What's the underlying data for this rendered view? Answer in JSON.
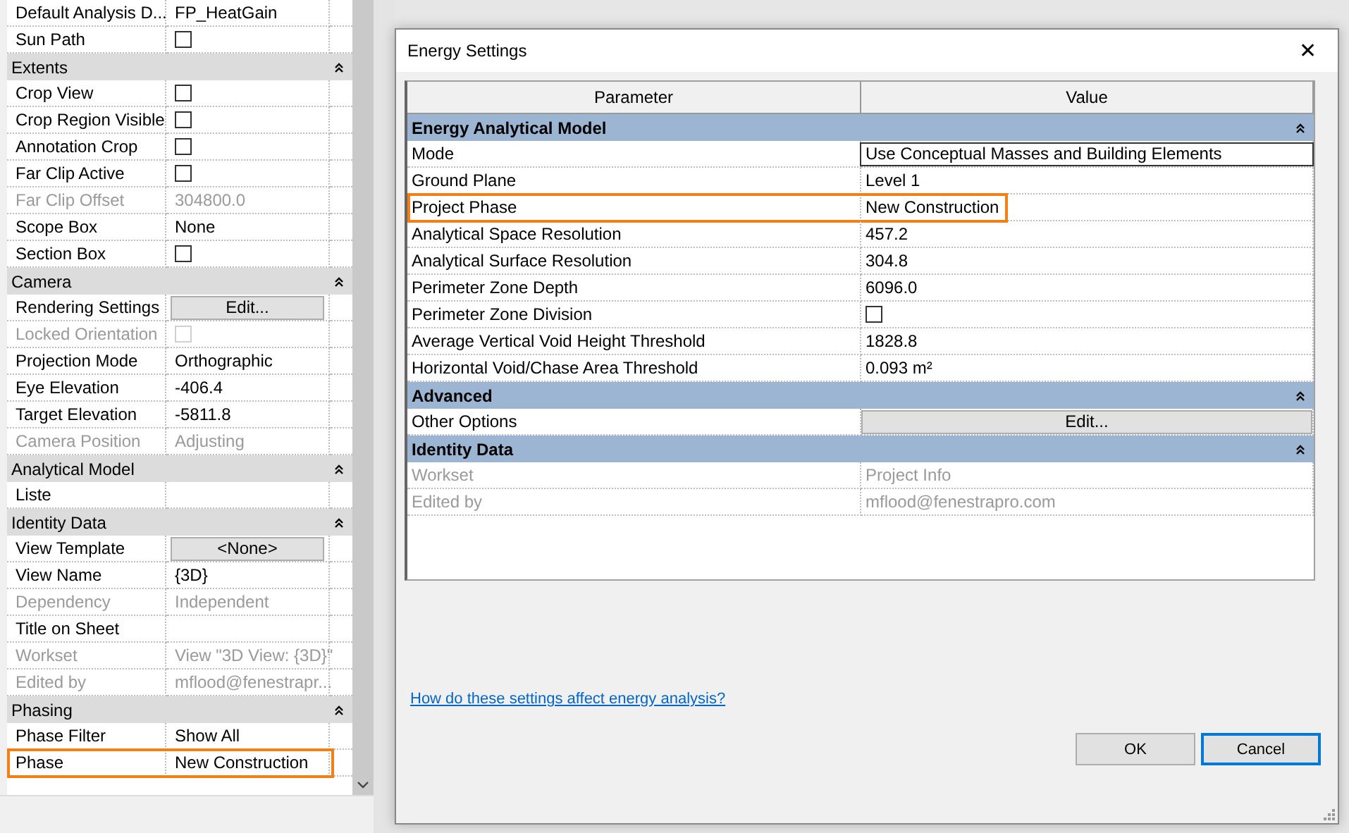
{
  "properties_panel": {
    "groups": [
      {
        "rows": [
          {
            "label": "Default Analysis D...",
            "kind": "text",
            "value": "FP_HeatGain",
            "disabled": false,
            "highlighted": false
          },
          {
            "label": "Sun Path",
            "kind": "checkbox",
            "checked": false,
            "disabled": false,
            "highlighted": false
          }
        ]
      },
      {
        "title": "Extents",
        "rows": [
          {
            "label": "Crop View",
            "kind": "checkbox",
            "checked": false,
            "disabled": false,
            "highlighted": false
          },
          {
            "label": "Crop Region Visible",
            "kind": "checkbox",
            "checked": false,
            "disabled": false,
            "highlighted": false
          },
          {
            "label": "Annotation Crop",
            "kind": "checkbox",
            "checked": false,
            "disabled": false,
            "highlighted": false
          },
          {
            "label": "Far Clip Active",
            "kind": "checkbox",
            "checked": false,
            "disabled": false,
            "highlighted": false
          },
          {
            "label": "Far Clip Offset",
            "kind": "text",
            "value": "304800.0",
            "disabled": true,
            "highlighted": false
          },
          {
            "label": "Scope Box",
            "kind": "text",
            "value": "None",
            "disabled": false,
            "highlighted": false
          },
          {
            "label": "Section Box",
            "kind": "checkbox",
            "checked": false,
            "disabled": false,
            "highlighted": false
          }
        ]
      },
      {
        "title": "Camera",
        "rows": [
          {
            "label": "Rendering Settings",
            "kind": "button",
            "value": "Edit...",
            "disabled": false,
            "highlighted": false
          },
          {
            "label": "Locked Orientation",
            "kind": "checkbox",
            "checked": false,
            "disabled": true,
            "highlighted": false
          },
          {
            "label": "Projection Mode",
            "kind": "text",
            "value": "Orthographic",
            "disabled": false,
            "highlighted": false
          },
          {
            "label": "Eye Elevation",
            "kind": "text",
            "value": "-406.4",
            "disabled": false,
            "highlighted": false
          },
          {
            "label": "Target Elevation",
            "kind": "text",
            "value": "-5811.8",
            "disabled": false,
            "highlighted": false
          },
          {
            "label": "Camera Position",
            "kind": "text",
            "value": "Adjusting",
            "disabled": true,
            "highlighted": false
          }
        ]
      },
      {
        "title": "Analytical Model",
        "rows": [
          {
            "label": "Liste",
            "kind": "text",
            "disabled": false,
            "highlighted": false
          }
        ]
      },
      {
        "title": "Identity Data",
        "rows": [
          {
            "label": "View Template",
            "kind": "button",
            "value": "<None>",
            "disabled": false,
            "highlighted": false
          },
          {
            "label": "View Name",
            "kind": "text",
            "value": "{3D}",
            "disabled": false,
            "highlighted": false
          },
          {
            "label": "Dependency",
            "kind": "text",
            "value": "Independent",
            "disabled": true,
            "highlighted": false
          },
          {
            "label": "Title on Sheet",
            "kind": "text",
            "disabled": false,
            "highlighted": false
          },
          {
            "label": "Workset",
            "kind": "text",
            "value": "View \"3D View: {3D}\"",
            "disabled": true,
            "highlighted": false
          },
          {
            "label": "Edited by",
            "kind": "text",
            "value": "mflood@fenestrapr...",
            "disabled": true,
            "highlighted": false
          }
        ]
      },
      {
        "title": "Phasing",
        "rows": [
          {
            "label": "Phase Filter",
            "kind": "text",
            "value": "Show All",
            "disabled": false,
            "highlighted": false
          },
          {
            "label": "Phase",
            "kind": "text",
            "value": "New Construction",
            "disabled": false,
            "highlighted": true
          }
        ]
      }
    ]
  },
  "dialog": {
    "title": "Energy Settings",
    "close": "✕",
    "columns": [
      "Parameter",
      "Value"
    ],
    "groups": [
      {
        "title": "Energy Analytical Model",
        "rows": [
          {
            "label": "Mode",
            "kind": "field",
            "value": "Use Conceptual Masses and Building Elements",
            "disabled": false,
            "highlighted": false
          },
          {
            "label": "Ground Plane",
            "kind": "text",
            "value": "Level 1",
            "disabled": false,
            "highlighted": false
          },
          {
            "label": "Project Phase",
            "kind": "text",
            "value": "New Construction",
            "disabled": false,
            "highlighted": true
          },
          {
            "label": "Analytical Space Resolution",
            "kind": "text",
            "value": "457.2",
            "disabled": false,
            "highlighted": false
          },
          {
            "label": "Analytical Surface Resolution",
            "kind": "text",
            "value": "304.8",
            "disabled": false,
            "highlighted": false
          },
          {
            "label": "Perimeter Zone Depth",
            "kind": "text",
            "value": "6096.0",
            "disabled": false,
            "highlighted": false
          },
          {
            "label": "Perimeter Zone Division",
            "kind": "checkbox",
            "checked": false,
            "disabled": false,
            "highlighted": false
          },
          {
            "label": "Average Vertical Void Height Threshold",
            "kind": "text",
            "value": "1828.8",
            "disabled": false,
            "highlighted": false
          },
          {
            "label": "Horizontal Void/Chase Area Threshold",
            "kind": "text",
            "value": "0.093 m²",
            "disabled": false,
            "highlighted": false
          }
        ]
      },
      {
        "title": "Advanced",
        "rows": [
          {
            "label": "Other Options",
            "kind": "button",
            "value": "Edit...",
            "disabled": false,
            "highlighted": false
          }
        ]
      },
      {
        "title": "Identity Data",
        "rows": [
          {
            "label": "Workset",
            "kind": "text",
            "value": "Project Info",
            "disabled": true,
            "highlighted": false
          },
          {
            "label": "Edited by",
            "kind": "text",
            "value": "mflood@fenestrapro.com",
            "disabled": true,
            "highlighted": false
          }
        ]
      }
    ],
    "help_link": "How do these settings affect energy analysis?",
    "buttons": [
      {
        "label": "OK",
        "selected": false
      },
      {
        "label": "Cancel",
        "selected": true
      }
    ]
  }
}
